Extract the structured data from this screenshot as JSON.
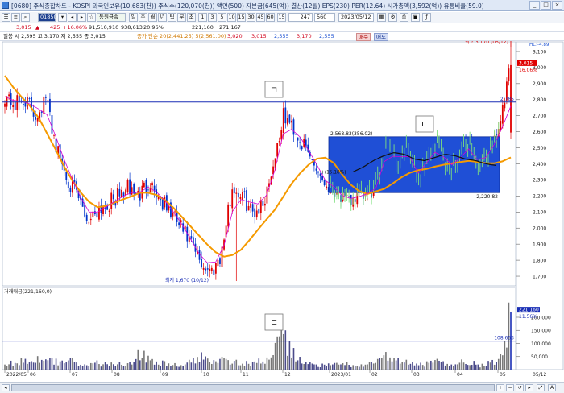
{
  "window": {
    "title": "[0680] 주식종합차트 - KOSPI 외국인보유(10,683(천)) 주식수(120,070(천)) 액면(500) 자본금(645(억)) 결산(12월) EPS(230) PER(12.64) 시가총액(3,592(억)) 유통비율(59.0)",
    "buttons": [
      "_",
      "□",
      "×"
    ]
  },
  "toolbar": {
    "code": "018500",
    "name": "동원금속",
    "periods": [
      "1",
      "3",
      "5",
      "10",
      "15",
      "30",
      "45",
      "60",
      "15"
    ],
    "count": "247",
    "count_suffix": "560",
    "date": "2023/05/12"
  },
  "pricebar": {
    "price": "3,015",
    "change": "425",
    "change_pct": "+16.06%",
    "volume": "91,510,910",
    "trade_value": "938,613",
    "turnover": "20.96%",
    "extra_left": "221,160",
    "extra_right": "271,167"
  },
  "infobar": {
    "ohlc": "일봉 시 2,595 고 3,170 저 2,555 종 3,015",
    "ma_legend": "종가 단순 20(2,441.25)  5(2,561.00)",
    "buy_label": "매수",
    "sell_label": "매도",
    "right_values": [
      "3,020",
      "3,015",
      "2,555",
      "3,170",
      "2,555"
    ]
  },
  "chart_data": {
    "type": "candlestick",
    "symbol": "동원금속",
    "price_axis": {
      "ticks": [
        "3,100",
        "3,000",
        "2,900",
        "2,800",
        "2,700",
        "2,600",
        "2,500",
        "2,400",
        "2,300",
        "2,200",
        "2,100",
        "2,000",
        "1,900",
        "1,800",
        "1,700"
      ],
      "ylim": [
        1640,
        3160
      ],
      "current_label": "3,015",
      "current_pct": "16.06%",
      "top_labels": [
        "LC:40.54",
        "HC:-4.89"
      ],
      "hline_label": "2,785"
    },
    "volume_axis": {
      "ticks": [
        "200,000",
        "150,000",
        "100,000",
        "50,000"
      ],
      "ylim": [
        0,
        280000
      ],
      "current_label": "221,160",
      "current_pct": "11.56%",
      "hline_label": "108,653"
    },
    "volume_title": "거래대금(221,160,0)",
    "x_labels": [
      "2022/05",
      "06",
      "07",
      "08",
      "09",
      "10",
      "11",
      "12",
      "2023/01",
      "02",
      "03",
      "04",
      "05",
      "05/12"
    ],
    "high_annotation": "최고 3,170 (05/12)",
    "low_annotation": "최저 1,670 (10/12)",
    "box_top_label": "2,568.83(356.02)",
    "box_bottom_label": "2,220.82",
    "box_mid_label": "+(15.18%)",
    "hangul_labels": [
      "ㄱ",
      "ㄴ",
      "ㄷ"
    ],
    "close_anchors": [
      [
        2830,
        2770,
        2800,
        2700,
        2810,
        2500,
        2320,
        2200,
        2050,
        2120,
        2150,
        2200,
        2250,
        2200,
        2300,
        2180,
        2100,
        2010,
        1900,
        1780,
        1730,
        1850,
        2250,
        2200,
        2100,
        2150,
        2400,
        2700,
        2620,
        2500,
        2400,
        2280,
        2250,
        2150,
        2200,
        2200,
        2260,
        2560,
        2400,
        2500,
        2300,
        2450,
        2550,
        2350,
        2450,
        2550,
        2350,
        2500,
        2650,
        3015
      ]
    ],
    "ma_series": [
      {
        "name": "20",
        "color": "#f59a00",
        "values": [
          2950,
          2860,
          2790,
          2720,
          2600,
          2480,
          2350,
          2250,
          2170,
          2130,
          2140,
          2170,
          2190,
          2220,
          2220,
          2200,
          2150,
          2080,
          2010,
          1940,
          1870,
          1820,
          1830,
          1870,
          1950,
          2030,
          2100,
          2200,
          2300,
          2370,
          2430,
          2440,
          2400,
          2300,
          2240,
          2210,
          2230,
          2250,
          2300,
          2340,
          2360,
          2370,
          2390,
          2400,
          2410,
          2420,
          2410,
          2400,
          2410,
          2440
        ]
      },
      {
        "name": "5",
        "color": "#d400d4",
        "values": [
          2820,
          2790,
          2790,
          2750,
          2720,
          2560,
          2380,
          2240,
          2100,
          2100,
          2140,
          2180,
          2220,
          2220,
          2260,
          2210,
          2130,
          2040,
          1930,
          1820,
          1760,
          1830,
          2100,
          2190,
          2150,
          2150,
          2320,
          2600,
          2620,
          2530,
          2420,
          2300,
          2250,
          2180,
          2190,
          2210,
          2250,
          2470,
          2430,
          2470,
          2340,
          2420,
          2500,
          2380,
          2430,
          2500,
          2400,
          2470,
          2600,
          2760
        ]
      },
      {
        "name": "box_ma",
        "color": "#111111",
        "values": [
          2350,
          2380,
          2420,
          2450,
          2470,
          2460,
          2430,
          2420,
          2440,
          2460,
          2450,
          2430,
          2420,
          2400,
          2390
        ]
      }
    ],
    "volume_anchors": [
      [
        20000,
        25000,
        40000,
        35000,
        55000,
        30000,
        45000,
        20000,
        15000,
        25000,
        18000,
        22000,
        30000,
        60000,
        40000,
        25000,
        20000,
        15000,
        28000,
        45000,
        35000,
        60000,
        30000,
        25000,
        20000,
        35000,
        70000,
        110000,
        55000,
        25000,
        20000,
        15000,
        18000,
        25000,
        12000,
        15000,
        35000,
        50000,
        30000,
        25000,
        18000,
        22000,
        30000,
        20000,
        25000,
        35000,
        15000,
        25000,
        40000,
        221160
      ]
    ]
  }
}
